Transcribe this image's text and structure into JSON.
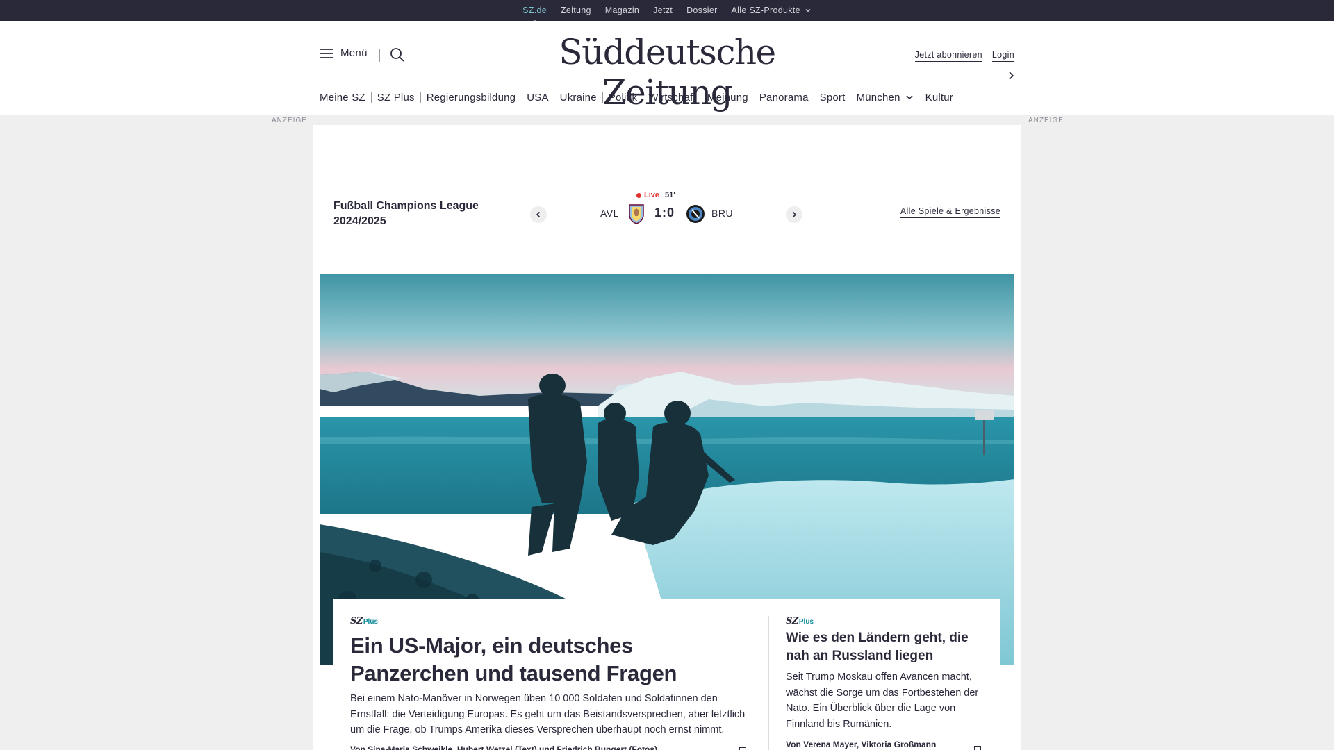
{
  "topbar": {
    "items": [
      "SZ.de",
      "Zeitung",
      "Magazin",
      "Jetzt",
      "Dossier",
      "Alle SZ-Produkte"
    ]
  },
  "header": {
    "menu_label": "Menü",
    "logo": "Süddeutsche Zeitung",
    "subscribe": "Jetzt abonnieren",
    "login": "Login"
  },
  "nav": {
    "items": [
      "Meine SZ",
      "SZ Plus",
      "Regierungsbildung",
      "USA",
      "Ukraine",
      "Politik",
      "Wirtschaft",
      "Meinung",
      "Panorama",
      "Sport",
      "München",
      "Kultur"
    ]
  },
  "ads": {
    "label": "ANZEIGE"
  },
  "scoreboard": {
    "competition": "Fußball Champions League 2024/2025",
    "live_label": "Live",
    "minute": "51'",
    "home_team": "AVL",
    "away_team": "BRU",
    "score": "1:0",
    "all_games": "Alle Spiele & Ergebnisse"
  },
  "articles": {
    "lead": {
      "badge_sz": "SZ",
      "badge_plus": "Plus",
      "title": "Ein US-Major, ein deutsches Panzerchen und tausend Fragen",
      "teaser": "Bei einem Nato-Manöver in Norwegen üben 10 000 Soldaten und Soldatinnen den Ernstfall: die Verteidigung Europas. Es geht um das Beistandsversprechen, aber letztlich um die Frage, ob Trumps Amerika dieses Versprechen überhaupt noch ernst nimmt.",
      "authors": "Von Sina-Maria Schweikle, Hubert Wetzel (Text) und Friedrich Bungert (Fotos)"
    },
    "second": {
      "badge_sz": "SZ",
      "badge_plus": "Plus",
      "title": "Wie es den Ländern geht, die nah an Russland liegen",
      "teaser": "Seit Trump Moskau offen Avancen macht, wächst die Sorge um das Fortbestehen der Nato. Ein Überblick über die Lage von Finnland bis Rumänien.",
      "authors": "Von Verena Mayer, Viktoria Großmann"
    }
  },
  "colors": {
    "brand_dark": "#29293a",
    "accent_teal": "#0f8a99",
    "live_red": "#e0302e"
  }
}
